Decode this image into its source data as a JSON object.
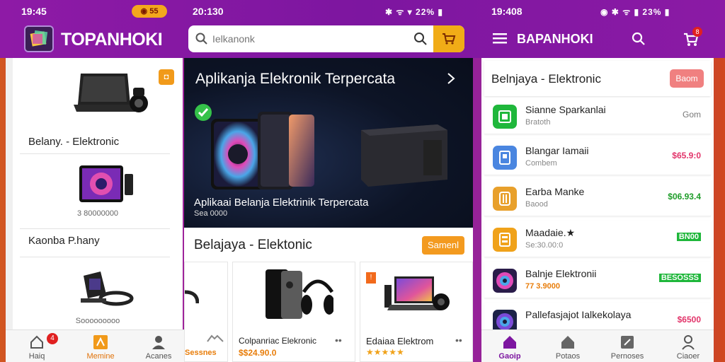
{
  "left": {
    "time": "19:45",
    "status_chip": "◉ 55",
    "app_name": "TOPANHOKI",
    "products": [
      {
        "label": "Belany. - Elektronic",
        "price": ""
      },
      {
        "label": "",
        "price": "3 80000000"
      },
      {
        "label": "Kaonba P.hany",
        "price": ""
      },
      {
        "label": "",
        "price": "Sooooooooo"
      }
    ],
    "nav": [
      {
        "label": "Haiq",
        "badge": "4"
      },
      {
        "label": "Memine"
      },
      {
        "label": "Acanes"
      }
    ]
  },
  "middle": {
    "time": "20:130",
    "status_icons": "✱ ᯤ ▾ 22% ▮",
    "search_placeholder": "Ielkanonk",
    "hero_title": "Aplikanja Elekronik Terpercata",
    "hero_sub": "Aplikaai Belanja Elektrinik Terpercata",
    "hero_sub2": "Sea 0000",
    "section_title": "Belajaya - Elektonic",
    "section_button": "Samenl",
    "cards": [
      {
        "name": "",
        "price": "Sessnes"
      },
      {
        "name": "Colpanriac Elekronic",
        "price": "$$24.90.0"
      },
      {
        "name": "Edaiaa Elektrom",
        "price": "★★★★★"
      }
    ]
  },
  "right": {
    "time": "19:408",
    "status_icons": "◉ ✱ ᯤ ▮ 23% ▮",
    "header_title": "BAPANHOKI",
    "cart_badge": "8",
    "list_title": "Belnjaya - Elektronic",
    "list_button": "Baom",
    "rows": [
      {
        "name": "Sianne Sparkanlai",
        "sub": "Bratoth",
        "value": "Gom",
        "value_color": "#777",
        "icon_color": "#1fb73b"
      },
      {
        "name": "Blangar Iamaii",
        "sub": "Combem",
        "value": "$65.9:0",
        "value_color": "#e2346a",
        "icon_color": "#4a86e0"
      },
      {
        "name": "Earba Manke",
        "sub": "Baood",
        "value": "$06.93.4",
        "value_color": "#1f9d2a",
        "icon_color": "#e8a02b"
      },
      {
        "name": "Maadaie.★",
        "sub": "Se:30.00:0",
        "value": "BN00",
        "value_color": "#1f9d2a",
        "icon_color": "#f0a21a"
      },
      {
        "name": "Balnje Elektronii",
        "sub": "77 3.9000",
        "value": "BESOSSS",
        "value_color": "#1f9d2a",
        "icon_color": "#2a1c4a"
      },
      {
        "name": "Pallefasjajot Ialkekolaya",
        "sub": "",
        "value": "$6500",
        "value_color": "#e2346a",
        "icon_color": "#1c2248"
      }
    ],
    "nav": [
      {
        "label": "Gaoip",
        "active": true
      },
      {
        "label": "Potaos"
      },
      {
        "label": "Pernoses"
      },
      {
        "label": "Ciaoer"
      }
    ]
  }
}
